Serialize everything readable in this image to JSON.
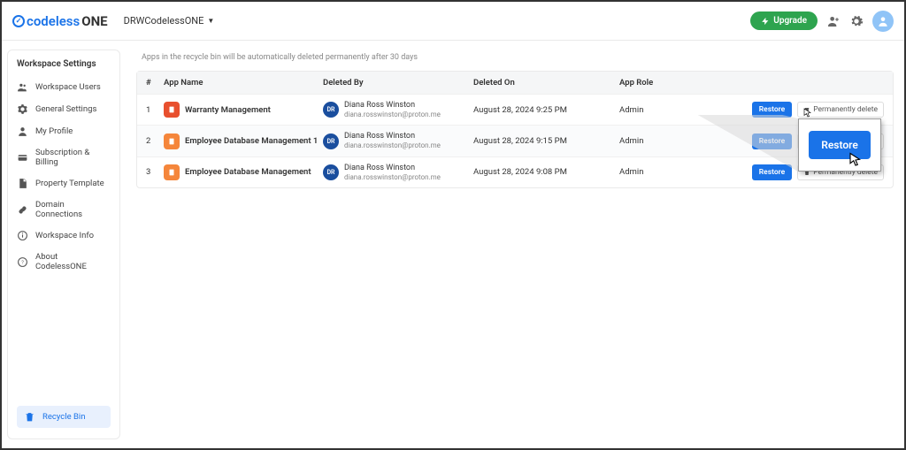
{
  "brand": {
    "prefix": "codeless",
    "suffix": "ONE"
  },
  "workspace_selector": "DRWCodelessONE",
  "header": {
    "upgrade": "Upgrade"
  },
  "sidebar": {
    "title": "Workspace Settings",
    "items": [
      {
        "label": "Workspace Users"
      },
      {
        "label": "General Settings"
      },
      {
        "label": "My Profile"
      },
      {
        "label": "Subscription & Billing"
      },
      {
        "label": "Property Template"
      },
      {
        "label": "Domain Connections"
      },
      {
        "label": "Workspace Info"
      },
      {
        "label": "About CodelessONE"
      }
    ],
    "recycle": "Recycle Bin"
  },
  "main": {
    "notice": "Apps in the recycle bin will be automatically deleted permanently after 30 days",
    "columns": {
      "idx": "#",
      "app": "App Name",
      "delby": "Deleted By",
      "delon": "Deleted On",
      "role": "App Role"
    },
    "restore_label": "Restore",
    "perm_delete_label": "Permanently delete",
    "rows": [
      {
        "idx": "1",
        "app": "Warranty Management",
        "color": "red",
        "user_init": "DR",
        "user_name": "Diana Ross Winston",
        "user_email": "diana.rosswinston@proton.me",
        "deleted_on": "August 28, 2024 9:25 PM",
        "role": "Admin"
      },
      {
        "idx": "2",
        "app": "Employee Database Management 1",
        "color": "orange",
        "user_init": "DR",
        "user_name": "Diana Ross Winston",
        "user_email": "diana.rosswinston@proton.me",
        "deleted_on": "August 28, 2024 9:15 PM",
        "role": "Admin"
      },
      {
        "idx": "3",
        "app": "Employee Database Management",
        "color": "orange",
        "user_init": "DR",
        "user_name": "Diana Ross Winston",
        "user_email": "diana.rosswinston@proton.me",
        "deleted_on": "August 28, 2024 9:08 PM",
        "role": "Admin"
      }
    ]
  },
  "callout": {
    "label": "Restore"
  }
}
